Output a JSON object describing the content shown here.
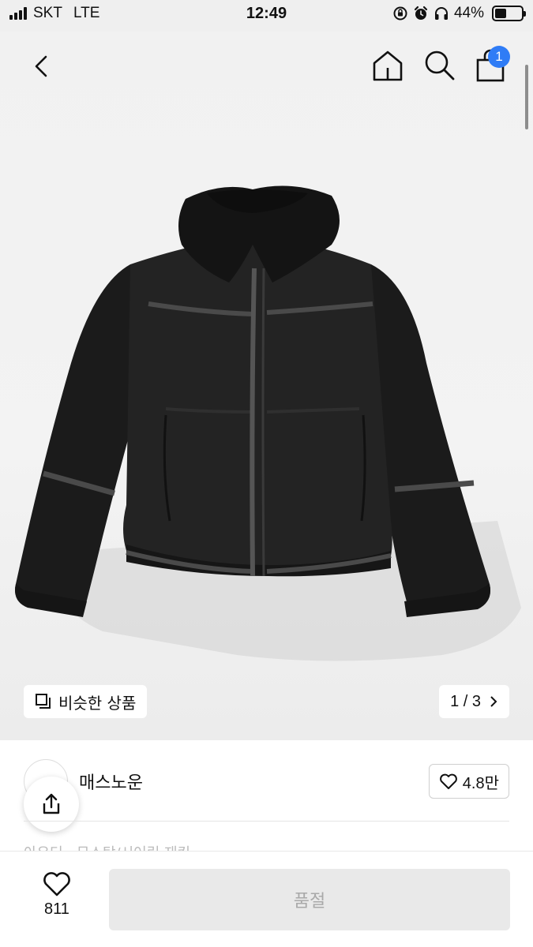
{
  "status_bar": {
    "carrier": "SKT",
    "network": "LTE",
    "time": "12:49",
    "battery_percent": "44%",
    "battery_level": 0.44,
    "icons": [
      "signal-icon",
      "rotation-lock-icon",
      "alarm-icon",
      "headphones-icon",
      "battery-icon"
    ]
  },
  "nav": {
    "icons": [
      "back-chevron-icon",
      "home-icon",
      "search-icon",
      "shopping-bag-icon"
    ],
    "cart_badge": "1"
  },
  "gallery": {
    "similar_label": "비슷한 상품",
    "pager": "1 / 3"
  },
  "product": {
    "brand": "매스노운",
    "likes": "4.8만",
    "partial_text": "아우터 · 무스탕/시어링 재킷 "
  },
  "bottom": {
    "wish_count": "811",
    "buy_label": "품절"
  },
  "colors": {
    "badge": "#2f7cf6",
    "disabled_button": "#e9e9e9",
    "disabled_text": "#a9a9a9"
  }
}
